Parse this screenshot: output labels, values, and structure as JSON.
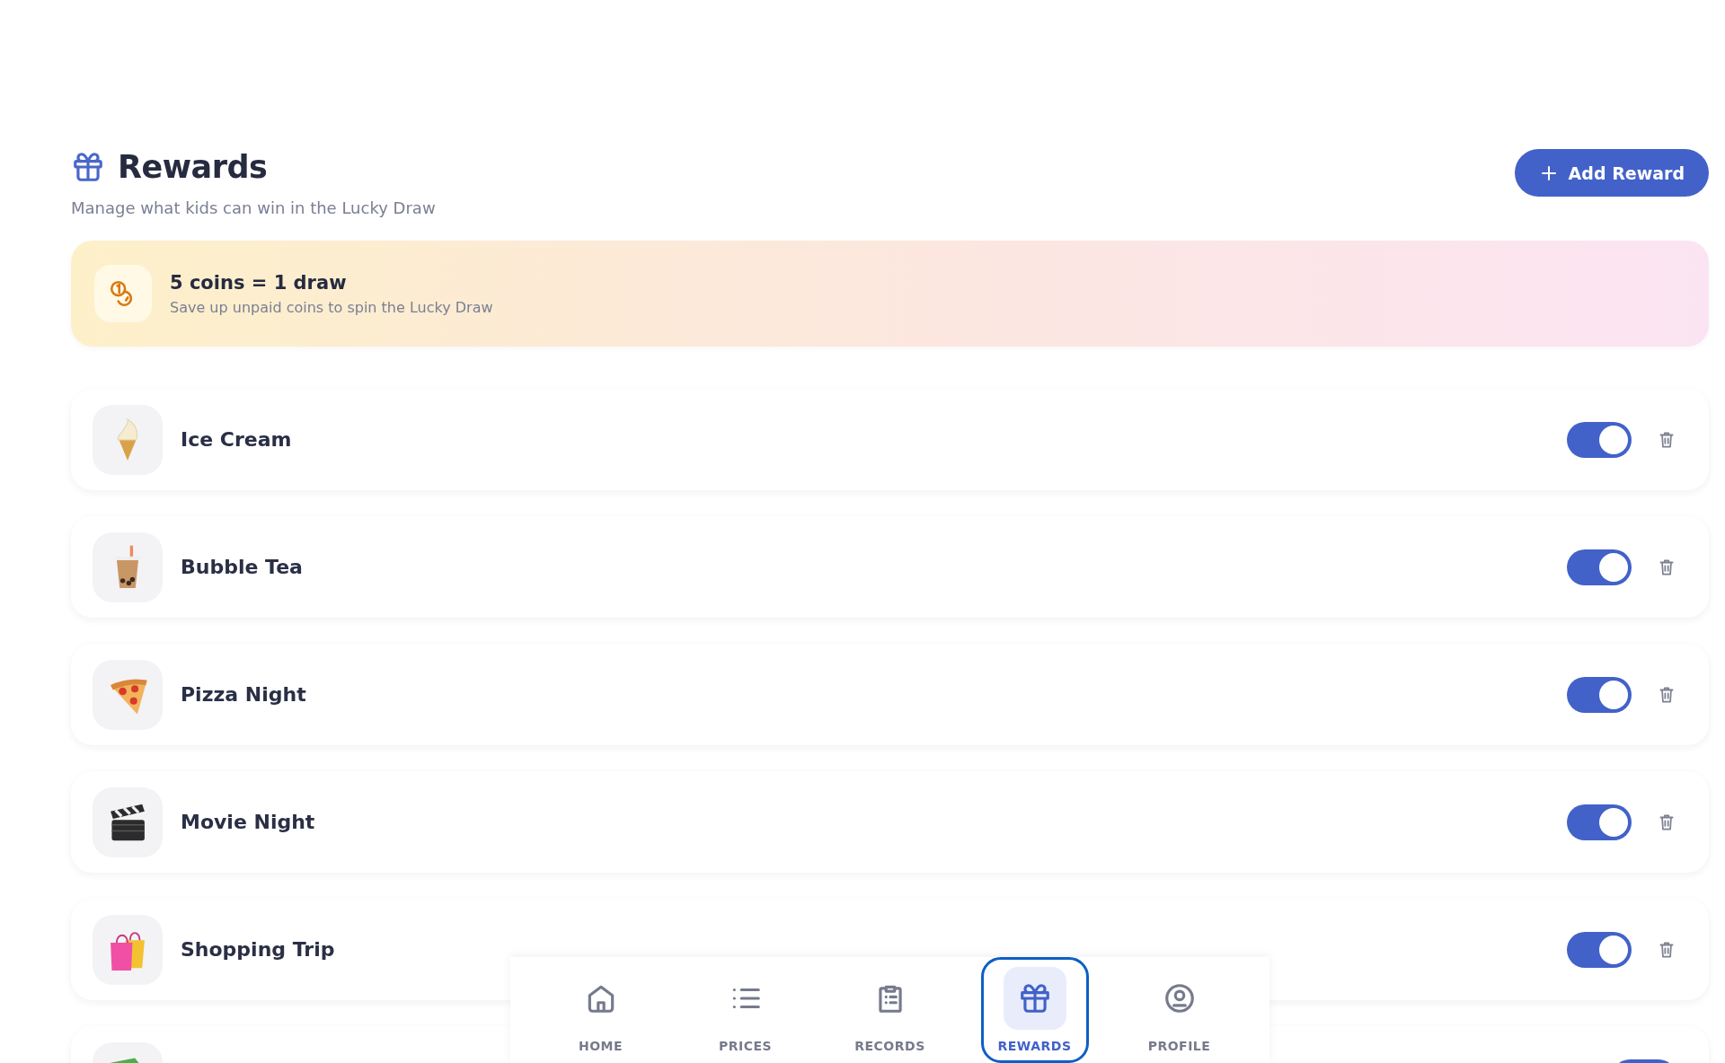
{
  "header": {
    "title": "Rewards",
    "subtitle": "Manage what kids can win in the Lucky Draw",
    "add_button": "Add Reward"
  },
  "banner": {
    "title": "5 coins = 1 draw",
    "subtitle": "Save up unpaid coins to spin the Lucky Draw"
  },
  "rewards": [
    {
      "name": "Ice Cream",
      "on": true
    },
    {
      "name": "Bubble Tea",
      "on": true
    },
    {
      "name": "Pizza Night",
      "on": true
    },
    {
      "name": "Movie Night",
      "on": true
    },
    {
      "name": "Shopping Trip",
      "on": true
    },
    {
      "on": true
    }
  ],
  "nav": [
    {
      "label": "HOME",
      "selected": false
    },
    {
      "label": "PRICES",
      "selected": false
    },
    {
      "label": "RECORDS",
      "selected": false
    },
    {
      "label": "REWARDS",
      "selected": true
    },
    {
      "label": "PROFILE",
      "selected": false
    }
  ]
}
